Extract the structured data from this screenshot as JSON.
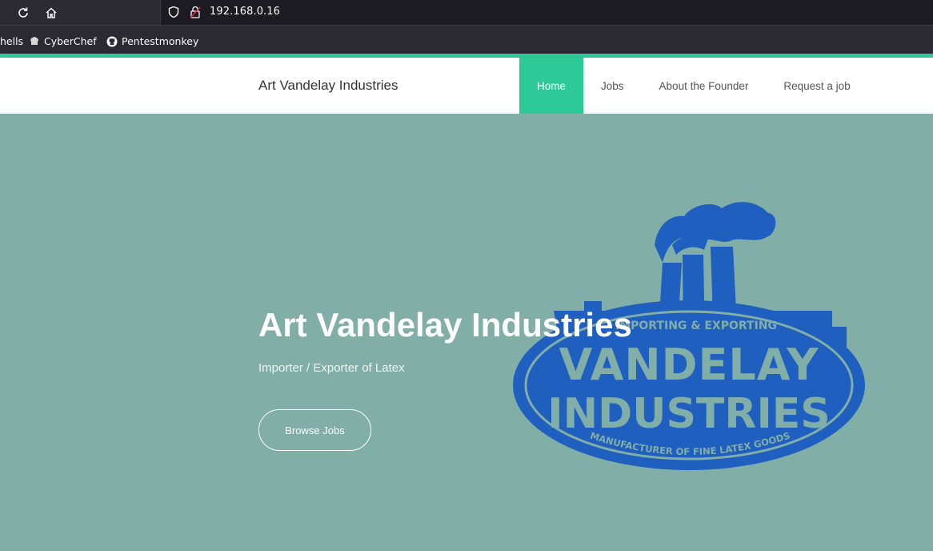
{
  "browser": {
    "url": "192.168.0.16",
    "bookmarks": [
      {
        "label": "hells",
        "icon": "none"
      },
      {
        "label": "CyberChef",
        "icon": "chef-hat-icon"
      },
      {
        "label": "Pentestmonkey",
        "icon": "github-icon"
      }
    ]
  },
  "site": {
    "brand": "Art Vandelay Industries",
    "nav": [
      {
        "label": "Home",
        "active": true
      },
      {
        "label": "Jobs",
        "active": false
      },
      {
        "label": "About the Founder",
        "active": false
      },
      {
        "label": "Request a job",
        "active": false
      }
    ],
    "accent_color": "#2dc997",
    "hero_bg_color": "#82aea8"
  },
  "hero": {
    "title": "Art Vandelay Industries",
    "subtitle": "Importer / Exporter of Latex",
    "button_label": "Browse Jobs"
  },
  "logo": {
    "top_text": "IMPORTING & EXPORTING",
    "line1": "VANDELAY",
    "line2": "INDUSTRIES",
    "bottom_text": "MANUFACTURER OF FINE LATEX GOODS",
    "color": "#1e5fbf"
  }
}
